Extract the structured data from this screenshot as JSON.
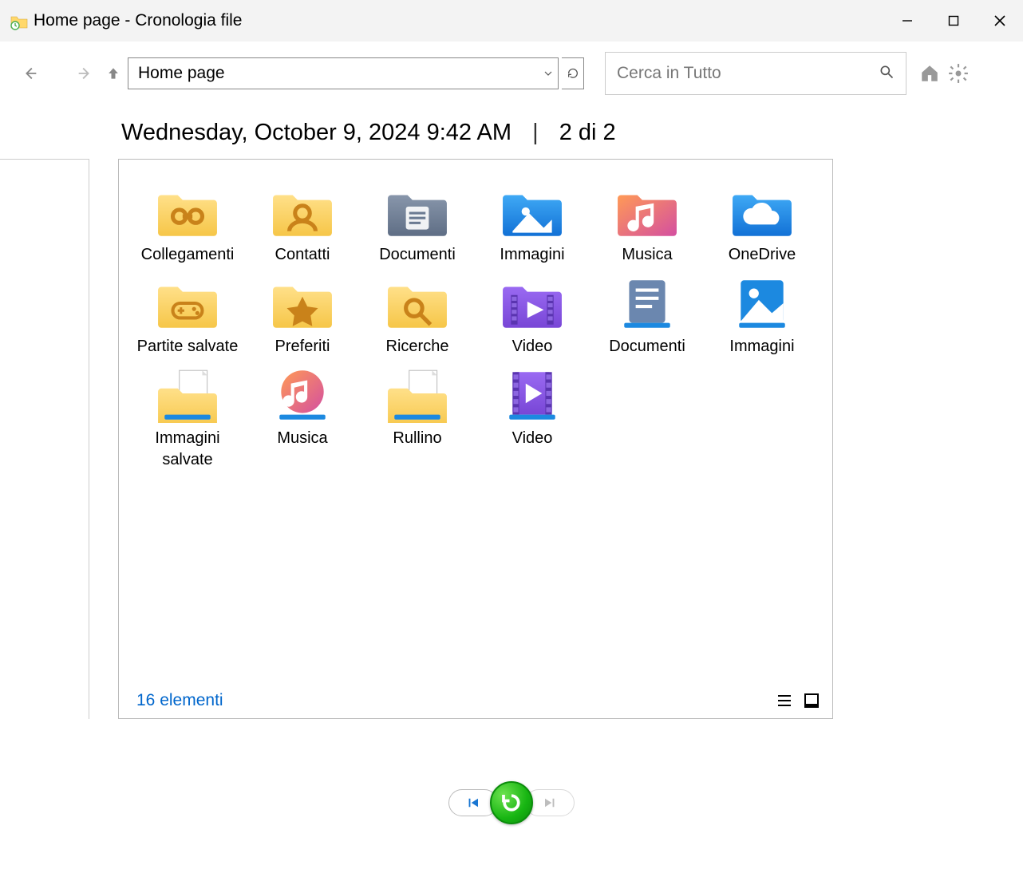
{
  "window": {
    "title": "Home page - Cronologia file"
  },
  "toolbar": {
    "address": "Home page",
    "search_placeholder": "Cerca in Tutto"
  },
  "header": {
    "timestamp": "Wednesday, October 9, 2024 9:42 AM",
    "separator": "|",
    "page_indicator": "2 di 2"
  },
  "items": [
    {
      "label": "Collegamenti",
      "icon": "folder-link"
    },
    {
      "label": "Contatti",
      "icon": "folder-contacts"
    },
    {
      "label": "Documenti",
      "icon": "folder-documents"
    },
    {
      "label": "Immagini",
      "icon": "folder-pictures"
    },
    {
      "label": "Musica",
      "icon": "folder-music"
    },
    {
      "label": "OneDrive",
      "icon": "folder-onedrive"
    },
    {
      "label": "Partite salvate",
      "icon": "folder-games"
    },
    {
      "label": "Preferiti",
      "icon": "folder-favorites"
    },
    {
      "label": "Ricerche",
      "icon": "folder-search"
    },
    {
      "label": "Video",
      "icon": "folder-videos"
    },
    {
      "label": "Documenti",
      "icon": "library-documents"
    },
    {
      "label": "Immagini",
      "icon": "library-pictures"
    },
    {
      "label": "Immagini salvate",
      "icon": "library-saved-pictures"
    },
    {
      "label": "Musica",
      "icon": "library-music"
    },
    {
      "label": "Rullino",
      "icon": "library-camera-roll"
    },
    {
      "label": "Video",
      "icon": "library-videos"
    }
  ],
  "panel": {
    "item_count": "16 elementi"
  }
}
